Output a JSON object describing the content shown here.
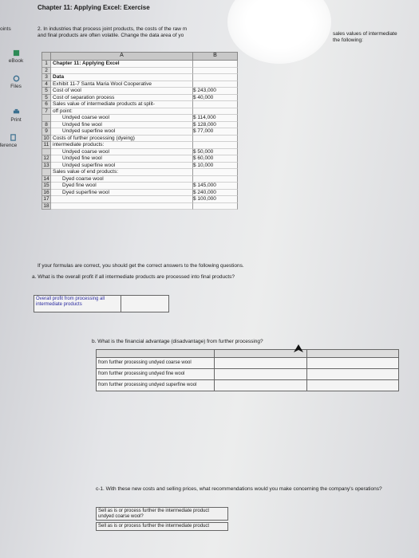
{
  "header": {
    "title": "Chapter 11: Applying Excel: Exercise"
  },
  "sidebar": {
    "items": [
      {
        "label": "oints",
        "icon": "points-icon"
      },
      {
        "label": "eBook",
        "icon": "ebook-icon",
        "color": "#2e8b57"
      },
      {
        "label": "Files",
        "icon": "files-icon"
      },
      {
        "label": "Print",
        "icon": "print-icon"
      },
      {
        "label": "eference",
        "icon": "reference-icon"
      }
    ]
  },
  "instructions": {
    "line1": "2. In industries that process joint products, the costs of the raw m",
    "line2": "and final products are often volatile. Change the data area of yo",
    "right_line1": "sales values of intermediate",
    "right_line2": "the following:"
  },
  "sheet": {
    "col_a": "A",
    "col_b": "B",
    "rows": [
      {
        "n": "1",
        "a": "Chapter 11: Applying Excel",
        "style": "bold",
        "b": ""
      },
      {
        "n": "2",
        "a": "",
        "b": ""
      },
      {
        "n": "3",
        "a": "Data",
        "style": "bold",
        "b": ""
      },
      {
        "n": "4",
        "a": "Exhibit 11-7 Santa Maria Wool Cooperative",
        "b": ""
      },
      {
        "n": "5",
        "a": "Cost of wool",
        "b": "$ 243,000"
      },
      {
        "n": "5",
        "a": "Cost of separation process",
        "b": "$ 40,000"
      },
      {
        "n": "6",
        "a": "Sales value of intermediate products at split-",
        "b": ""
      },
      {
        "n": "7",
        "a": "off point:",
        "b": ""
      },
      {
        "n": "",
        "a": "Undyed coarse wool",
        "style": "indent",
        "b": "$ 114,000"
      },
      {
        "n": "8",
        "a": "Undyed fine wool",
        "style": "indent",
        "b": "$ 128,000"
      },
      {
        "n": "9",
        "a": "Undyed superfine wool",
        "style": "indent",
        "b": "$ 77,000"
      },
      {
        "n": "10",
        "a": "Costs of further processing (dyeing)",
        "b": ""
      },
      {
        "n": "11",
        "a": "intermediate products:",
        "b": ""
      },
      {
        "n": "",
        "a": "Undyed coarse wool",
        "style": "indent",
        "b": "$ 50,000"
      },
      {
        "n": "12",
        "a": "Undyed fine wool",
        "style": "indent",
        "b": "$ 60,000"
      },
      {
        "n": "13",
        "a": "Undyed superfine wool",
        "style": "indent",
        "b": "$ 10,000"
      },
      {
        "n": "",
        "a": "Sales value of end products:",
        "b": ""
      },
      {
        "n": "14",
        "a": "Dyed coarse wool",
        "style": "indent",
        "b": ""
      },
      {
        "n": "15",
        "a": "Dyed fine wool",
        "style": "indent",
        "b": "$ 145,000"
      },
      {
        "n": "16",
        "a": "Dyed superfine wool",
        "style": "indent",
        "b": "$ 240,000"
      },
      {
        "n": "17",
        "a": "",
        "b": "$ 100,000"
      },
      {
        "n": "18",
        "a": "",
        "b": ""
      }
    ]
  },
  "questions": {
    "intro": "If your formulas are correct, you should get the correct answers to the following questions.",
    "a": "a. What is the overall profit if all intermediate products are processed into final products?",
    "a_label": "Overall profit from processing all intermediate products",
    "b": "b. What is the financial advantage (disadvantage) from further processing?",
    "b_rows": [
      "from further processing undyed coarse wool",
      "from further processing undyed fine wool",
      "from further processing undyed superfine wool"
    ],
    "c": "c-1. With these new costs and selling prices, what recommendations would you make concerning the company's operations?",
    "c_opt1": "Sell as is or process further the intermediate product undyed coarse wool?",
    "c_opt2": "Sell as is or process further the intermediate product"
  }
}
